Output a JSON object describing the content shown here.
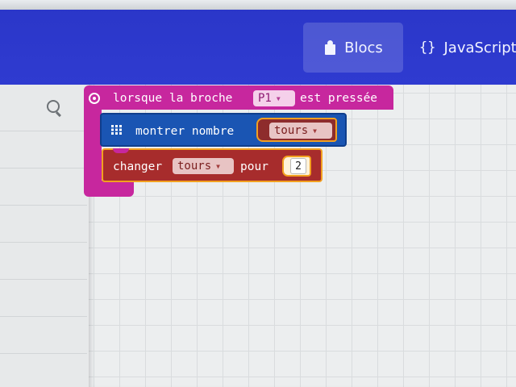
{
  "header": {
    "tabs": [
      {
        "label": "Blocs",
        "icon": "puzzle-piece-icon",
        "active": true
      },
      {
        "label": "JavaScript",
        "icon": "braces-icon",
        "glyph": "{}",
        "active": false
      }
    ]
  },
  "toolbox": {
    "search_icon": "search-icon"
  },
  "blocks": {
    "event": {
      "prefix": "lorsque la broche",
      "pin": "P1",
      "suffix": "est pressée",
      "color": "#c7279e"
    },
    "show_number": {
      "label": "montrer nombre",
      "variable": "tours",
      "color": "#1a55b3"
    },
    "change_var": {
      "label": "changer",
      "variable": "tours",
      "by_label": "pour",
      "value": "2",
      "color": "#a72c2c"
    }
  },
  "colors": {
    "header_blue": "#2f3bd0",
    "workspace_bg": "#eceeef"
  }
}
